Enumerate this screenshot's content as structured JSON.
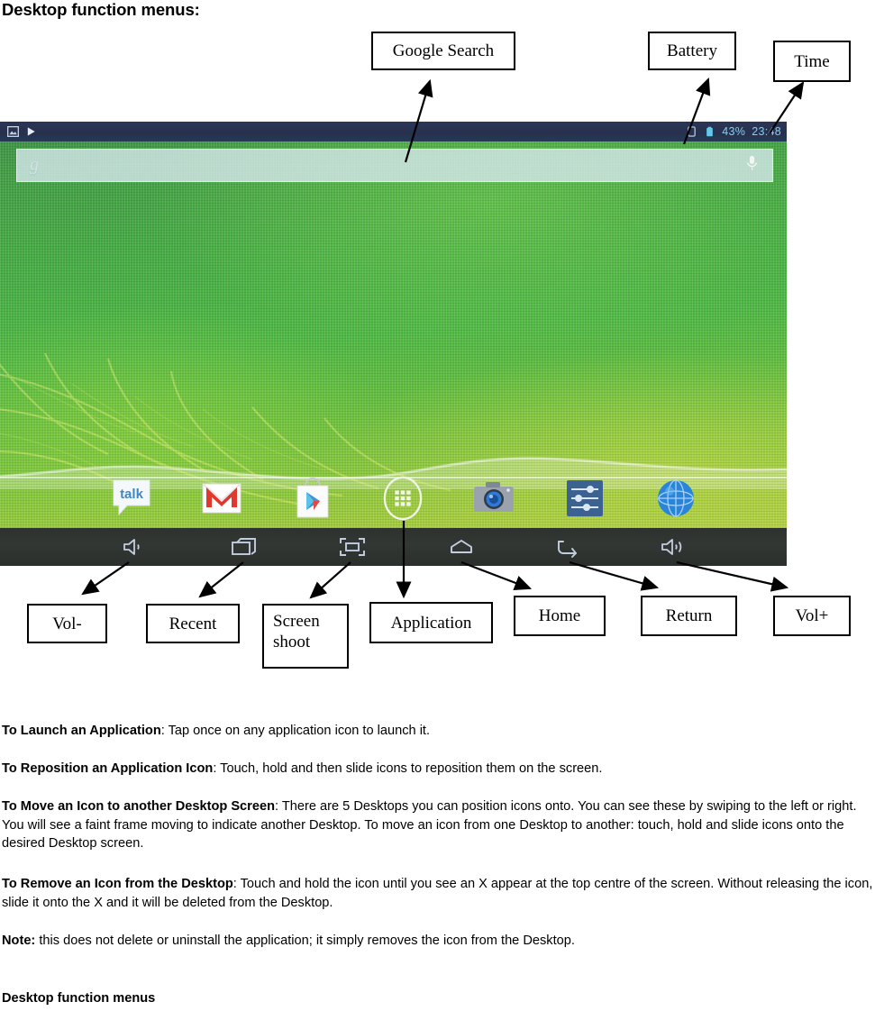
{
  "page": {
    "title": "Desktop function menus:",
    "footer_title": "Desktop function menus"
  },
  "callouts": {
    "google_search": "Google Search",
    "battery": "Battery",
    "time": "Time",
    "vol_down": "Vol-",
    "recent": "Recent",
    "screenshot_line1": "Screen",
    "screenshot_line2": "shoot",
    "application": "Application",
    "home": "Home",
    "return": "Return",
    "vol_up": "Vol+"
  },
  "tablet": {
    "status_bar": {
      "battery_percent": "43%",
      "time": "23:48",
      "icons": [
        "image-icon",
        "play-icon",
        "sim-icon",
        "battery-icon"
      ]
    },
    "search_widget": {
      "logo_text": "g",
      "mic_icon": "microphone-icon"
    },
    "dock": [
      {
        "name": "talk-icon",
        "label": "talk"
      },
      {
        "name": "gmail-icon",
        "label": "M"
      },
      {
        "name": "play-store-icon",
        "label": ""
      },
      {
        "name": "app-drawer-icon",
        "label": ""
      },
      {
        "name": "camera-icon",
        "label": ""
      },
      {
        "name": "settings-icon",
        "label": ""
      },
      {
        "name": "browser-icon",
        "label": ""
      }
    ],
    "navbar": [
      {
        "name": "volume-down-icon"
      },
      {
        "name": "recent-apps-icon"
      },
      {
        "name": "screenshot-icon"
      },
      {
        "name": "home-icon"
      },
      {
        "name": "back-icon"
      },
      {
        "name": "volume-up-icon"
      }
    ]
  },
  "body": {
    "p1_bold": "To Launch an Application",
    "p1_rest": ": Tap once on any application icon to launch it.",
    "p2_bold": "To Reposition an Application Icon",
    "p2_rest": ": Touch, hold and then slide icons to reposition them on the screen.",
    "p3_bold": "To Move an Icon to another Desktop Screen",
    "p3_rest": ": There are 5 Desktops you can position icons onto. You can see these by swiping to the left or right. You will see a faint frame moving to indicate another Desktop. To move an icon from one Desktop to another: touch, hold and slide icons onto the desired Desktop screen.",
    "p4_bold": "To Remove an Icon from the Desktop",
    "p4_rest": ": Touch and hold the icon until you see an X appear at the top centre of the screen. Without releasing the icon, slide it onto the X and it will be deleted from the Desktop.",
    "p5_bold": "Note:",
    "p5_rest": " this does not delete or uninstall the application; it simply removes the icon from the Desktop."
  },
  "colors": {
    "ink": "#000000",
    "paper": "#ffffff",
    "status_text": "#7fd2f0",
    "navbar": "#30342f"
  }
}
